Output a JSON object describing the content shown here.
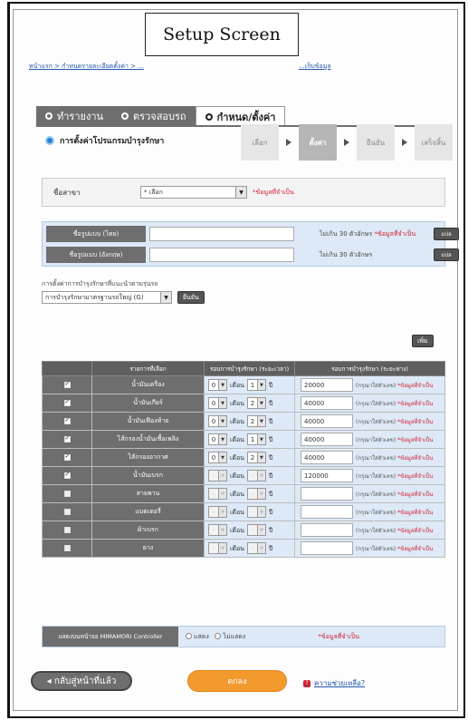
{
  "overlay_label": "Setup Screen",
  "breadcrumb": {
    "left": "หน้าแรก > กำหนดรายละเอียดตั้งค่า > ...",
    "right": "...เก็บข้อมูล"
  },
  "tabs": [
    {
      "label": "ทำรายงาน",
      "active": false
    },
    {
      "label": "ตรวจสอบรถ",
      "active": false
    },
    {
      "label": "กำหนด/ตั้งค่า",
      "active": true
    }
  ],
  "section_title": "การตั้งค่าโปรแกรมบำรุงรักษา",
  "steps": [
    {
      "label": "เลือก",
      "active": false
    },
    {
      "label": "ตั้งค่า",
      "active": true
    },
    {
      "label": "ยืนยัน",
      "active": false
    },
    {
      "label": "เสร็จสิ้น",
      "active": false
    }
  ],
  "branch": {
    "label": "ชื่อสาขา",
    "value": "* เลือก",
    "required": "*ข้อมูลที่จำเป็น"
  },
  "names": {
    "thai_label": "ชื่อรูปแบบ (ไทย)",
    "eng_label": "ชื่อรูปแบบ (อังกฤษ)",
    "thai_hint": "ไม่เกิน 30 ตัวอักษร",
    "thai_req": "*ข้อมูลที่จำเป็น",
    "eng_hint": "ไม่เกิน 30 ตัวอักษร",
    "button": "แปล"
  },
  "program": {
    "meta": "การตั้งค่าการบำรุงรักษาที่แนะนำตามรุ่นรถ",
    "select_value": "การบำรุงรักษามาตรฐานรถใหญ่ (G)",
    "confirm": "ยืนยัน"
  },
  "add_button": "เพิ่ม",
  "table": {
    "headers": [
      "",
      "รายการที่เลือก",
      "รอบการบำรุงรักษา (ระยะเวลา)",
      "รอบการบำรุงรักษา (ระยะทาง)"
    ],
    "month_unit": "เดือน",
    "year_unit": "ปี",
    "dist_note": "(กรุณาใส่ตัวเลข)",
    "dist_req": "*ข้อมูลที่จำเป็น",
    "rows": [
      {
        "name": "น้ำมันเครื่อง",
        "checked": true,
        "y": "0",
        "m": "1",
        "distance": "20000"
      },
      {
        "name": "น้ำมันเกียร์",
        "checked": true,
        "y": "0",
        "m": "2",
        "distance": "40000"
      },
      {
        "name": "น้ำมันเฟืองท้าย",
        "checked": true,
        "y": "0",
        "m": "2",
        "distance": "40000"
      },
      {
        "name": "ไส้กรองน้ำมันเชื้อเพลิง",
        "checked": true,
        "y": "0",
        "m": "1",
        "distance": "40000"
      },
      {
        "name": "ไส้กรองอากาศ",
        "checked": true,
        "y": "0",
        "m": "2",
        "distance": "40000"
      },
      {
        "name": "น้ำมันเบรก",
        "checked": true,
        "y": "-",
        "m": "-",
        "distance": "120000"
      },
      {
        "name": "สายพาน",
        "checked": false,
        "y": "-",
        "m": "-",
        "distance": ""
      },
      {
        "name": "แบตเตอรี่",
        "checked": false,
        "y": "-",
        "m": "-",
        "distance": ""
      },
      {
        "name": "ผ้าเบรก",
        "checked": false,
        "y": "-",
        "m": "-",
        "distance": ""
      },
      {
        "name": "ยาง",
        "checked": false,
        "y": "-",
        "m": "-",
        "distance": ""
      }
    ]
  },
  "controller": {
    "label": "แสดงบนหน้าจอ MIMAMORI Controller",
    "show": "แสดง",
    "hide": "ไม่แสดง",
    "required": "*ข้อมูลที่จำเป็น"
  },
  "footer": {
    "back": "◂ กลับสู่หน้าที่แล้ว",
    "save": "ตกลง",
    "help": "ความช่วยเหลือ?"
  }
}
